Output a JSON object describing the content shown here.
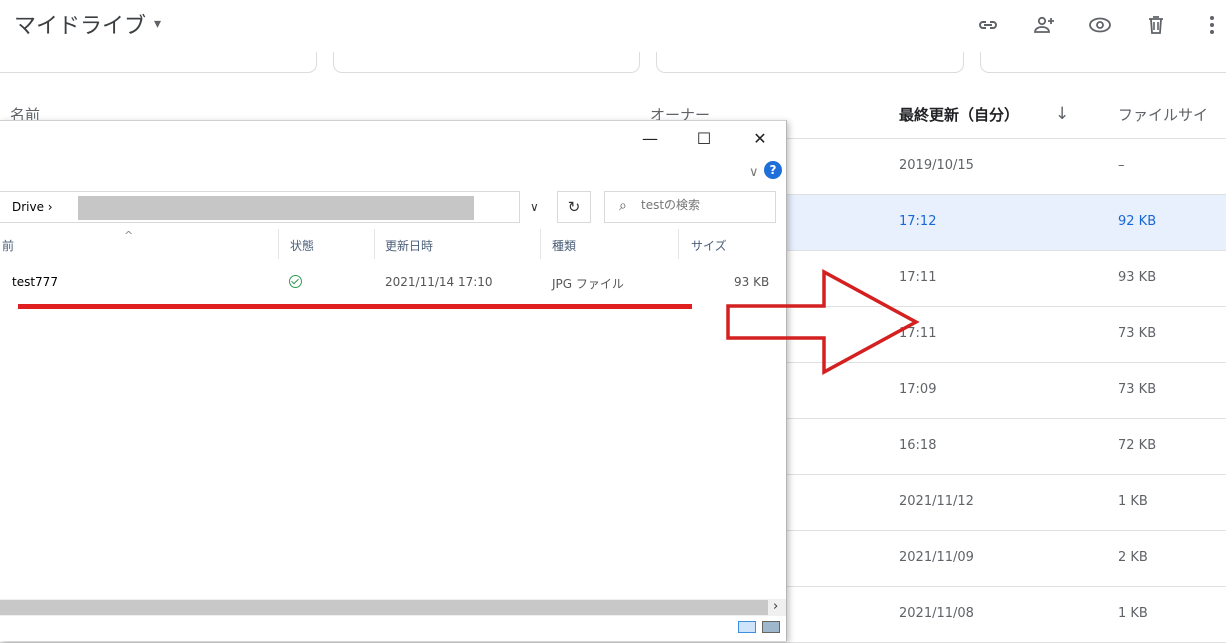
{
  "drive": {
    "title": "マイドライブ",
    "title_caret": "▾",
    "toolbar": [
      {
        "name": "link-icon"
      },
      {
        "name": "share-icon"
      },
      {
        "name": "preview-icon"
      },
      {
        "name": "trash-icon"
      },
      {
        "name": "more-icon"
      }
    ],
    "columns": {
      "name": "名前",
      "owner": "オーナー",
      "modified": "最終更新（自分）",
      "sort_icon": "↓",
      "size": "ファイルサイ"
    },
    "rows": [
      {
        "modified": "2019/10/15",
        "size": "–",
        "selected": false
      },
      {
        "modified": "17:12",
        "size": "92 KB",
        "selected": true
      },
      {
        "modified": "17:11",
        "size": "93 KB",
        "selected": false
      },
      {
        "modified": "17:11",
        "size": "73 KB",
        "selected": false
      },
      {
        "modified": "17:09",
        "size": "73 KB",
        "selected": false
      },
      {
        "modified": "16:18",
        "size": "72 KB",
        "selected": false
      },
      {
        "modified": "2021/11/12",
        "size": "1 KB",
        "selected": false
      },
      {
        "modified": "2021/11/09",
        "size": "2 KB",
        "selected": false
      },
      {
        "modified": "2021/11/08",
        "size": "1 KB",
        "selected": false
      }
    ]
  },
  "explorer": {
    "window_controls": {
      "minimize": "—",
      "maximize": "☐",
      "close": "✕"
    },
    "ribbon_toggle": "∨",
    "help": "?",
    "address": "Drive ›",
    "address_dropdown": "∨",
    "refresh": "↻",
    "search_icon": "⌕",
    "search_placeholder": "testの検索",
    "columns": {
      "name_partial": "前",
      "sort_indicator": "^",
      "status": "状態",
      "modified": "更新日時",
      "type": "種類",
      "size": "サイズ"
    },
    "files": [
      {
        "name": "test777",
        "status": "synced",
        "modified": "2021/11/14 17:10",
        "type": "JPG ファイル",
        "size": "93 KB"
      }
    ],
    "scroll_arrow": "›"
  }
}
